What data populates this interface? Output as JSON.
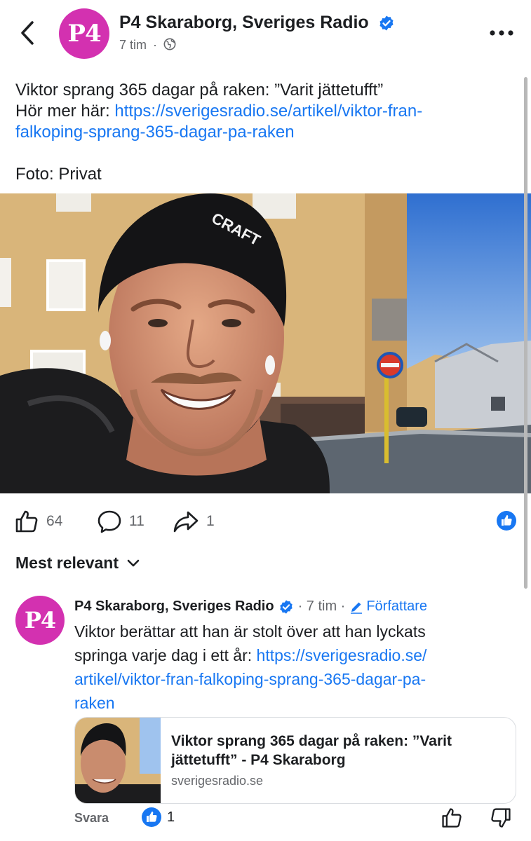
{
  "header": {
    "avatar_text": "P4",
    "page_name": "P4 Skaraborg, Sveriges Radio",
    "time": "7 tim",
    "separator": "·"
  },
  "post": {
    "line1": "Viktor sprang 365 dagar på raken: ”Varit jättetufft”",
    "line2_prefix": "Hör mer här: ",
    "link_part1": "https://sverigesradio.se/artikel/viktor-fran-",
    "link_part2": "falkoping-sprang-365-dagar-pa-raken",
    "photo_credit": "Foto: Privat"
  },
  "actions": {
    "likes": "64",
    "comments": "11",
    "shares": "1"
  },
  "sort_label": "Mest relevant",
  "comment": {
    "avatar_text": "P4",
    "author": "P4 Skaraborg, Sveriges Radio",
    "time": "· 7 tim ·",
    "author_badge": "Författare",
    "text_line1": "Viktor berättar att han är stolt över att han lyckats",
    "text_line2_prefix": "springa varje dag i ett år: ",
    "link_line1": "https://sverigesradio.se/",
    "link_line2": "artikel/viktor-fran-falkoping-sprang-365-dagar-pa-",
    "link_line3": "raken",
    "card": {
      "title": "Viktor sprang 365 dagar på raken: ”Varit jättetufft” - P4 Skaraborg",
      "domain": "sverigesradio.se"
    },
    "reply_label": "Svara",
    "reaction_count": "1"
  },
  "colors": {
    "brand": "#d331b0",
    "link": "#1877f2",
    "secondary_text": "#65676b"
  }
}
